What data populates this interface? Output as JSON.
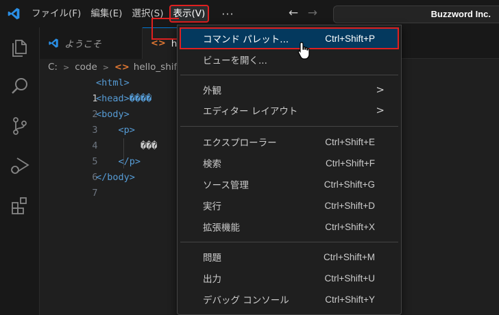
{
  "menubar": {
    "items": [
      {
        "label": "ファイル(F)"
      },
      {
        "label": "編集(E)"
      },
      {
        "label": "選択(S)"
      },
      {
        "label": "表示(V)",
        "active": true
      }
    ],
    "more_label": "···",
    "back_arrow": "←",
    "forward_arrow": "→",
    "search_title": "Buzzword Inc."
  },
  "tabs": [
    {
      "label": "ようこそ",
      "icon": "vscode-logo-icon"
    },
    {
      "label": "he",
      "icon": "html-file-icon",
      "icon_text": "<>"
    }
  ],
  "breadcrumb": {
    "items": [
      "C:",
      "code",
      "hello_shift"
    ],
    "separator": ">",
    "file_icon_text": "<>"
  },
  "editor": {
    "lines": [
      {
        "num": "1",
        "code": "<html>"
      },
      {
        "num": "2",
        "code": "<head>����"
      },
      {
        "num": "3",
        "code": "<body>"
      },
      {
        "num": "4",
        "code": "    <p>"
      },
      {
        "num": "5",
        "code": "        ���"
      },
      {
        "num": "6",
        "code": "    </p>"
      },
      {
        "num": "7",
        "code": "</body>"
      }
    ]
  },
  "view_menu": {
    "groups": [
      [
        {
          "label": "コマンド パレット...",
          "shortcut": "Ctrl+Shift+P",
          "highlighted": true
        },
        {
          "label": "ビューを開く...",
          "shortcut": ""
        }
      ],
      [
        {
          "label": "外観",
          "submenu": true,
          "chevron": ">"
        },
        {
          "label": "エディター レイアウト",
          "submenu": true,
          "chevron": ">"
        }
      ],
      [
        {
          "label": "エクスプローラー",
          "shortcut": "Ctrl+Shift+E"
        },
        {
          "label": "検索",
          "shortcut": "Ctrl+Shift+F"
        },
        {
          "label": "ソース管理",
          "shortcut": "Ctrl+Shift+G"
        },
        {
          "label": "実行",
          "shortcut": "Ctrl+Shift+D"
        },
        {
          "label": "拡張機能",
          "shortcut": "Ctrl+Shift+X"
        }
      ],
      [
        {
          "label": "問題",
          "shortcut": "Ctrl+Shift+M"
        },
        {
          "label": "出力",
          "shortcut": "Ctrl+Shift+U"
        },
        {
          "label": "デバッグ コンソール",
          "shortcut": "Ctrl+Shift+Y"
        }
      ]
    ]
  },
  "activity_icons": [
    "explorer-icon",
    "search-icon",
    "source-control-icon",
    "run-debug-icon",
    "extensions-icon"
  ],
  "colors": {
    "accent": "#0078d4",
    "highlight_bg": "#04395e",
    "annotation_red": "#e02020",
    "tag_blue": "#569cd6",
    "html_icon_orange": "#e37933"
  }
}
